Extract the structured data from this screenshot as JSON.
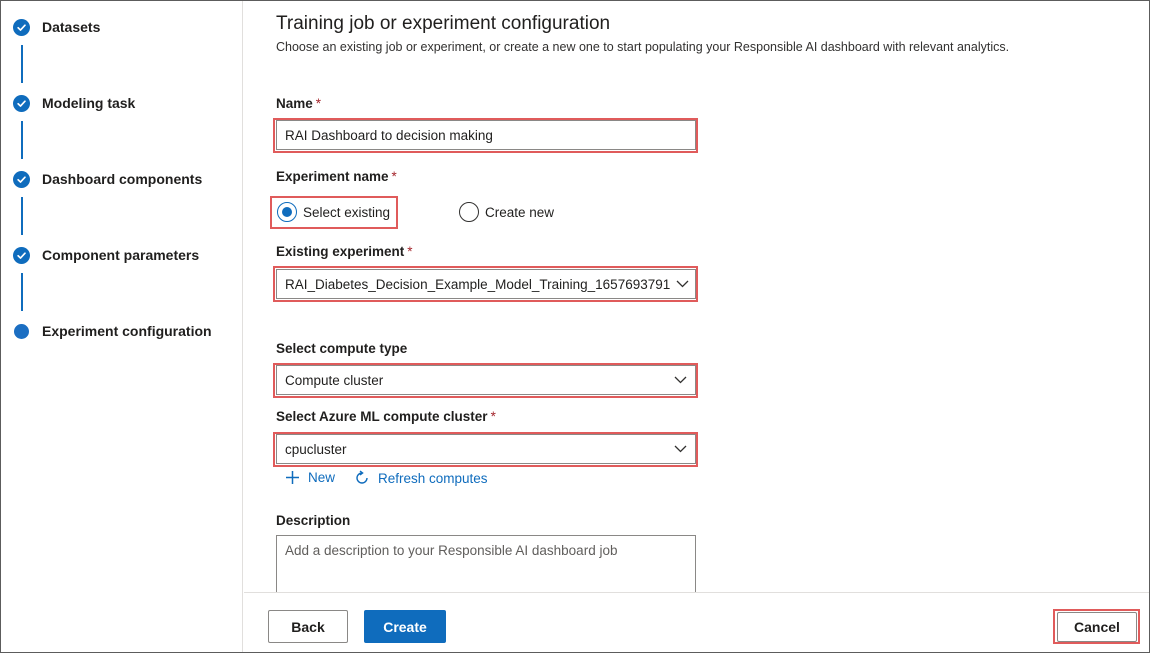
{
  "steps": [
    {
      "label": "Datasets",
      "status": "completed"
    },
    {
      "label": "Modeling task",
      "status": "completed"
    },
    {
      "label": "Dashboard components",
      "status": "completed"
    },
    {
      "label": "Component parameters",
      "status": "completed"
    },
    {
      "label": "Experiment configuration",
      "status": "current"
    }
  ],
  "page": {
    "title": "Training job or experiment configuration",
    "subtitle": "Choose an existing job or experiment, or create a new one to start populating your Responsible AI dashboard with relevant analytics."
  },
  "form": {
    "name": {
      "label": "Name",
      "required": "*",
      "value": "RAI Dashboard to decision making"
    },
    "experiment_name": {
      "label": "Experiment name",
      "required": "*",
      "options": [
        "Select existing",
        "Create new"
      ],
      "selected": "Select existing"
    },
    "existing_experiment": {
      "label": "Existing experiment",
      "required": "*",
      "value": "RAI_Diabetes_Decision_Example_Model_Training_1657693791"
    },
    "compute_type": {
      "label": "Select compute type",
      "value": "Compute cluster"
    },
    "compute_cluster": {
      "label": "Select Azure ML compute cluster",
      "required": "*",
      "value": "cpucluster"
    },
    "actions": {
      "new": "New",
      "refresh": "Refresh computes"
    },
    "description": {
      "label": "Description",
      "placeholder": "Add a description to your Responsible AI dashboard job"
    }
  },
  "footer": {
    "back": "Back",
    "create": "Create",
    "cancel": "Cancel"
  },
  "colors": {
    "accent": "#0f6cbd",
    "highlight": "#e05b5b",
    "required": "#a4262c"
  }
}
